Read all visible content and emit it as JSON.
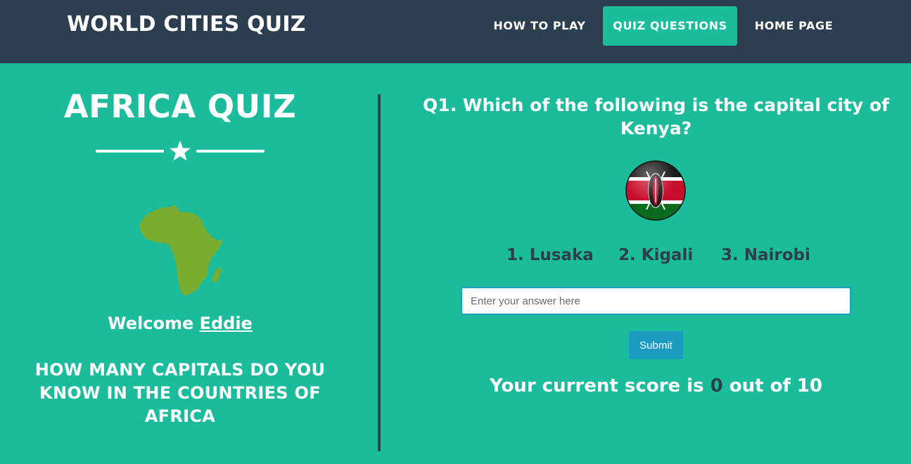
{
  "navbar": {
    "brand": "WORLD CITIES QUIZ",
    "links": [
      "HOW TO PLAY",
      "QUIZ QUESTIONS",
      "HOME PAGE"
    ],
    "active": "QUIZ QUESTIONS"
  },
  "left": {
    "title": "AFRICA QUIZ",
    "divider_icon": "star-icon",
    "map_icon": "africa-map",
    "welcome_prefix": "Welcome ",
    "user_name": "Eddie",
    "tagline": "HOW MANY CAPITALS DO YOU KNOW IN THE COUNTRIES OF AFRICA"
  },
  "quiz": {
    "question": "Q1. Which of the following is the capital city of Kenya?",
    "flag_icon": "kenya-flag",
    "options": [
      "1. Lusaka",
      "2. Kigali",
      "3. Nairobi"
    ],
    "answer_placeholder": "Enter your answer here",
    "answer_value": "",
    "submit_label": "Submit",
    "score_prefix": "Your current score is ",
    "score_value": "0",
    "score_suffix": " out of 10"
  },
  "colors": {
    "navbar_bg": "#2c3e50",
    "page_bg": "#1abc9c",
    "active_tab": "#1abc9c",
    "submit_bg": "#1a9bc0",
    "option_text": "#2c3e50"
  }
}
